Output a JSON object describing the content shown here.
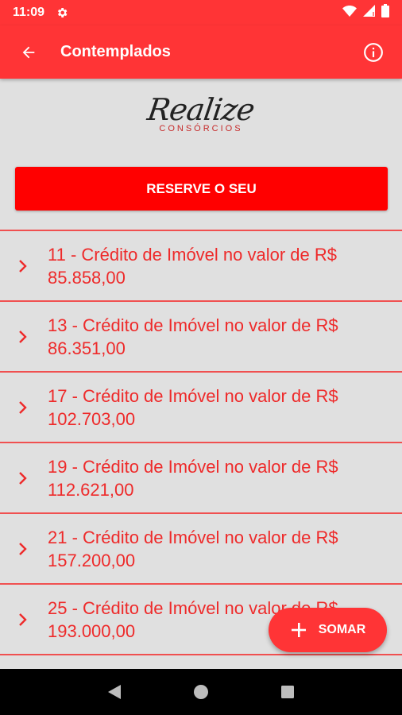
{
  "status_bar": {
    "time": "11:09",
    "icons": [
      "gear-icon",
      "wifi-icon",
      "signal-icon",
      "battery-icon"
    ]
  },
  "app_bar": {
    "title": "Contemplados",
    "back_icon": "arrow-left-icon",
    "info_icon": "info-icon"
  },
  "logo": {
    "name": "Realize",
    "subtitle": "CONSÓRCIOS"
  },
  "reserve_button": {
    "label": "RESERVE O SEU"
  },
  "items": [
    {
      "label": "11 - Crédito de Imóvel no valor de R$ 85.858,00"
    },
    {
      "label": "13 - Crédito de Imóvel no valor de R$ 86.351,00"
    },
    {
      "label": "17 - Crédito de Imóvel no valor de R$ 102.703,00"
    },
    {
      "label": "19 - Crédito de Imóvel no valor de R$ 112.621,00"
    },
    {
      "label": "21 - Crédito de Imóvel no valor de R$ 157.200,00"
    },
    {
      "label": "25 - Crédito de Imóvel no valor de R$ 193.000,00"
    }
  ],
  "fab": {
    "label": "SOMAR",
    "icon": "plus-icon"
  },
  "nav_bar": {
    "buttons": [
      "back-triangle-icon",
      "home-circle-icon",
      "recents-square-icon"
    ]
  },
  "colors": {
    "primary": "#ff3436",
    "accent_button": "#ff0000",
    "item_text": "#ee2a2a",
    "background": "#e0e0e0"
  }
}
